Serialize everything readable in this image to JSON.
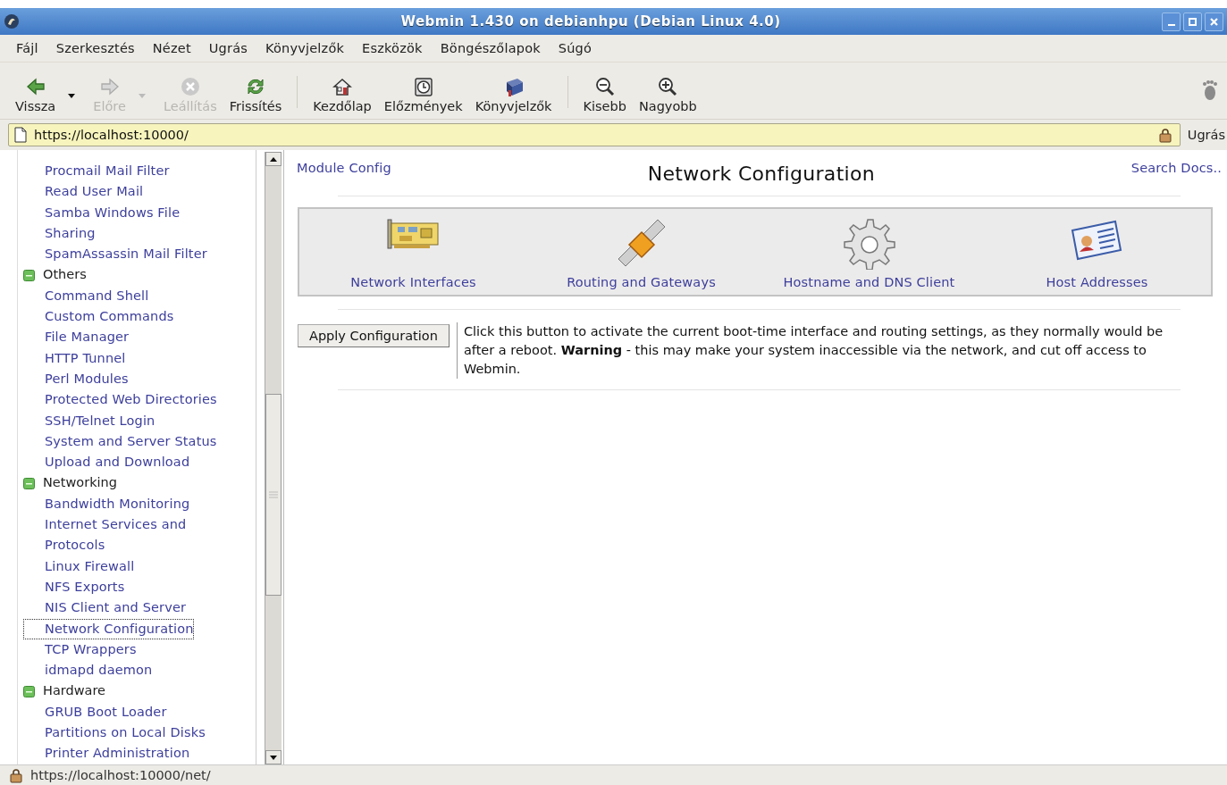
{
  "window": {
    "title": "Webmin 1.430 on debianhpu (Debian Linux 4.0)"
  },
  "menu": [
    "Fájl",
    "Szerkesztés",
    "Nézet",
    "Ugrás",
    "Könyvjelzők",
    "Eszközök",
    "Böngészőlapok",
    "Súgó"
  ],
  "toolbar": [
    {
      "kind": "back",
      "label": "Vissza",
      "disabled": false,
      "dropdown": true
    },
    {
      "kind": "forward",
      "label": "Előre",
      "disabled": true,
      "dropdown": true
    },
    {
      "kind": "stop",
      "label": "Leállítás",
      "disabled": true,
      "dropdown": false
    },
    {
      "kind": "reload",
      "label": "Frissítés",
      "disabled": false,
      "dropdown": false
    },
    {
      "kind": "separator"
    },
    {
      "kind": "home",
      "label": "Kezdőlap",
      "disabled": false,
      "dropdown": false
    },
    {
      "kind": "history",
      "label": "Előzmények",
      "disabled": false,
      "dropdown": false
    },
    {
      "kind": "bookmarks",
      "label": "Könyvjelzők",
      "disabled": false,
      "dropdown": false
    },
    {
      "kind": "separator"
    },
    {
      "kind": "zoom_out",
      "label": "Kisebb",
      "disabled": false,
      "dropdown": false
    },
    {
      "kind": "zoom_in",
      "label": "Nagyobb",
      "disabled": false,
      "dropdown": false
    }
  ],
  "address_bar": {
    "url": "https://localhost:10000/",
    "secure": true,
    "go_button": "Ugrás"
  },
  "sidebar": {
    "leading_items": [
      {
        "label": "Procmail Mail Filter",
        "selected": false
      },
      {
        "label": "Read User Mail",
        "selected": false
      },
      {
        "label": "Samba Windows File Sharing",
        "selected": false
      },
      {
        "label": "SpamAssassin Mail Filter",
        "selected": false
      }
    ],
    "categories": [
      {
        "label": "Others",
        "expanded": true,
        "children": [
          {
            "label": "Command Shell",
            "selected": false
          },
          {
            "label": "Custom Commands",
            "selected": false
          },
          {
            "label": "File Manager",
            "selected": false
          },
          {
            "label": "HTTP Tunnel",
            "selected": false
          },
          {
            "label": "Perl Modules",
            "selected": false
          },
          {
            "label": "Protected Web Directories",
            "selected": false
          },
          {
            "label": "SSH/Telnet Login",
            "selected": false
          },
          {
            "label": "System and Server Status",
            "selected": false
          },
          {
            "label": "Upload and Download",
            "selected": false
          }
        ]
      },
      {
        "label": "Networking",
        "expanded": true,
        "children": [
          {
            "label": "Bandwidth Monitoring",
            "selected": false
          },
          {
            "label": "Internet Services and Protocols",
            "selected": false
          },
          {
            "label": "Linux Firewall",
            "selected": false
          },
          {
            "label": "NFS Exports",
            "selected": false
          },
          {
            "label": "NIS Client and Server",
            "selected": false
          },
          {
            "label": "Network Configuration",
            "selected": true
          },
          {
            "label": "TCP Wrappers",
            "selected": false
          },
          {
            "label": "idmapd daemon",
            "selected": false
          }
        ]
      },
      {
        "label": "Hardware",
        "expanded": true,
        "children": [
          {
            "label": "GRUB Boot Loader",
            "selected": false
          },
          {
            "label": "Partitions on Local Disks",
            "selected": false
          },
          {
            "label": "Printer Administration",
            "selected": false
          }
        ]
      }
    ]
  },
  "main": {
    "module_config": "Module Config",
    "title": "Network Configuration",
    "search_docs": "Search Docs..",
    "modules": [
      {
        "kind": "interfaces",
        "label": "Network Interfaces"
      },
      {
        "kind": "routing",
        "label": "Routing and Gateways"
      },
      {
        "kind": "dns",
        "label": "Hostname and DNS Client"
      },
      {
        "kind": "hosts",
        "label": "Host Addresses"
      }
    ],
    "apply_button": "Apply Configuration",
    "apply_description": "Click this button to activate the current boot-time interface and routing settings, as they normally would be after a reboot. **Warning** - this may make your system inaccessible via the network, and cut off access to Webmin."
  },
  "status_bar": {
    "url": "https://localhost:10000/net/",
    "secure": true
  }
}
